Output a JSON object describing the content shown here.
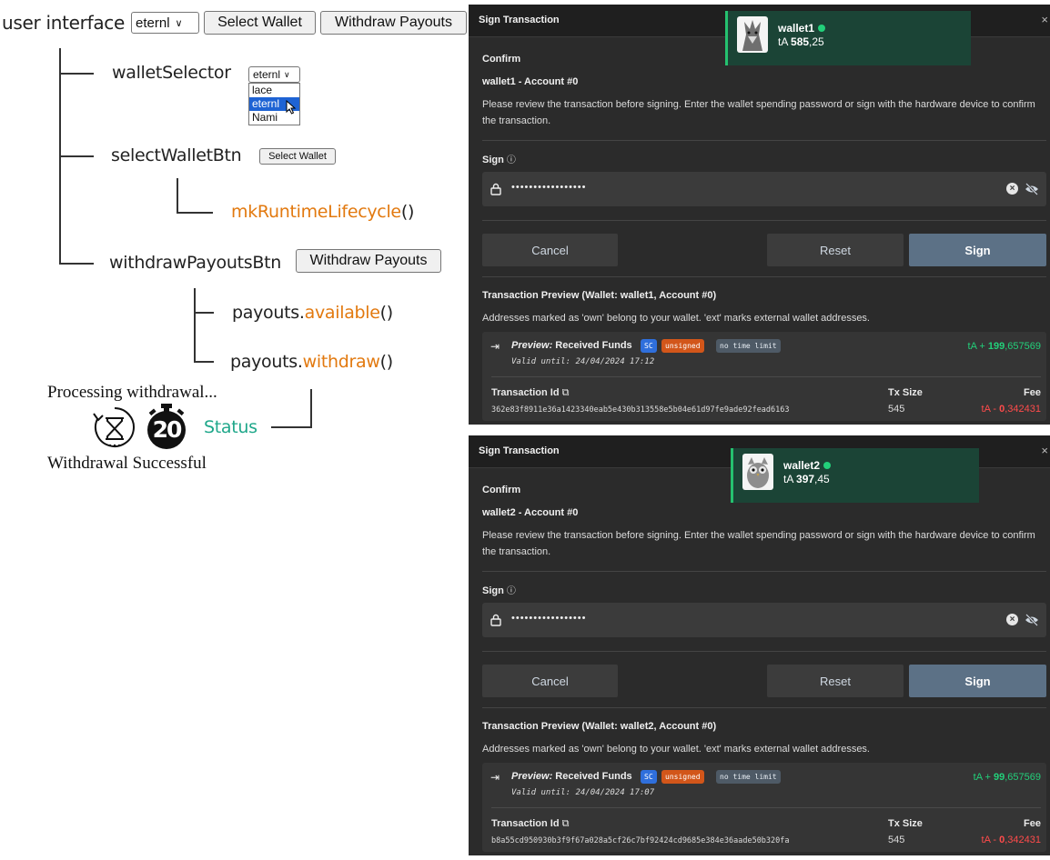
{
  "diagram": {
    "root_label": "user interface",
    "root_select_value": "eternl",
    "root_select_button": "Select Wallet",
    "root_withdraw_button": "Withdraw Payouts",
    "wallet_selector_label": "walletSelector",
    "wallet_selector_value": "eternl",
    "wallet_options": [
      "lace",
      "eternl",
      "Nami"
    ],
    "select_wallet_btn_label": "selectWalletBtn",
    "select_wallet_btn_text": "Select Wallet",
    "runtime_fn": "mkRuntimeLifecycle",
    "runtime_parens": "()",
    "withdraw_btn_label": "withdrawPayoutsBtn",
    "withdraw_btn_text": "Withdraw Payouts",
    "payouts_obj": "payouts.",
    "available_fn": "available",
    "withdraw_fn": "withdraw",
    "parens": "()",
    "processing_text": "Processing withdrawal...",
    "timer_value": "20",
    "status_label": "Status",
    "success_text": "Withdrawal Successful",
    "highlight_color": "#e2790f",
    "status_color": "#1fa78a"
  },
  "panels": [
    {
      "header_title": "Sign Transaction",
      "wallet_name": "wallet1",
      "balance_prefix": "tA ",
      "balance_int": "585",
      "balance_dec": ",25",
      "confirm_label": "Confirm",
      "account_label": "wallet1 - Account #0",
      "instructions": "Please review the transaction before signing. Enter the wallet spending password or sign with the hardware device to confirm the transaction.",
      "sign_label": "Sign",
      "password_mask": "•••••••••••••••••",
      "cancel_button": "Cancel",
      "reset_button": "Reset",
      "sign_button": "Sign",
      "preview_title": "Transaction Preview (Wallet: wallet1, Account #0)",
      "preview_note": "Addresses marked as 'own' belong to your wallet. 'ext' marks external wallet addresses.",
      "tx_title_italic": "Preview:",
      "tx_title_rest": " Received Funds",
      "badge_sc": "SC",
      "badge_unsigned": "unsigned",
      "badge_time": "no time limit",
      "amount_prefix": "tA + ",
      "amount_int": "199",
      "amount_dec": ",657569",
      "valid_until": "Valid until: 24/04/2024 17:12",
      "txid_label": "Transaction Id",
      "txid": "362e83f8911e36a1423340eab5e430b313558e5b04e61d97fe9ade92fead6163",
      "txsize_label": "Tx Size",
      "txsize": "545",
      "fee_label": "Fee",
      "fee_prefix": "tA - ",
      "fee_int": "0",
      "fee_dec": ",342431"
    },
    {
      "header_title": "Sign Transaction",
      "wallet_name": "wallet2",
      "balance_prefix": "tA ",
      "balance_int": "397",
      "balance_dec": ",45",
      "confirm_label": "Confirm",
      "account_label": "wallet2 - Account #0",
      "instructions": "Please review the transaction before signing. Enter the wallet spending password or sign with the hardware device to confirm the transaction.",
      "sign_label": "Sign",
      "password_mask": "•••••••••••••••••",
      "cancel_button": "Cancel",
      "reset_button": "Reset",
      "sign_button": "Sign",
      "preview_title": "Transaction Preview (Wallet: wallet2, Account #0)",
      "preview_note": "Addresses marked as 'own' belong to your wallet. 'ext' marks external wallet addresses.",
      "tx_title_italic": "Preview:",
      "tx_title_rest": " Received Funds",
      "badge_sc": "SC",
      "badge_unsigned": "unsigned",
      "badge_time": "no time limit",
      "amount_prefix": "tA + ",
      "amount_int": "99",
      "amount_dec": ",657569",
      "valid_until": "Valid until: 24/04/2024 17:07",
      "txid_label": "Transaction Id",
      "txid": "b8a55cd950930b3f9f67a028a5cf26c7bf92424cd9685e384e36aade50b320fa",
      "txsize_label": "Tx Size",
      "txsize": "545",
      "fee_label": "Fee",
      "fee_prefix": "tA - ",
      "fee_int": "0",
      "fee_dec": ",342431"
    }
  ]
}
